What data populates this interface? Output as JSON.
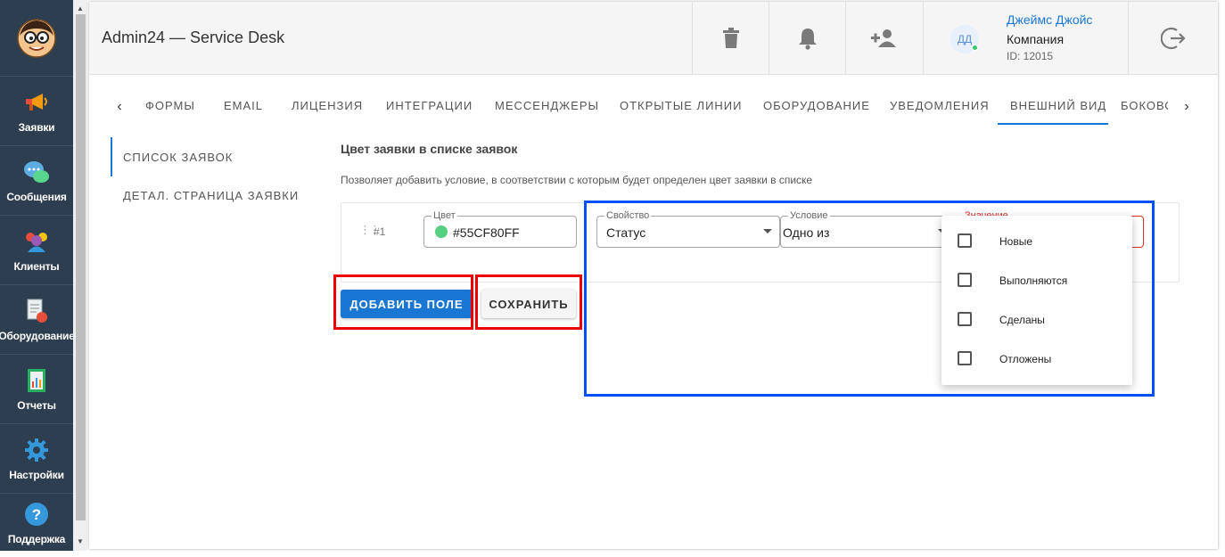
{
  "sidebar": {
    "items": [
      {
        "label": "Заявки",
        "icon": "megaphone-icon"
      },
      {
        "label": "Сообщения",
        "icon": "chat-bubbles-icon"
      },
      {
        "label": "Клиенты",
        "icon": "users-group-icon"
      },
      {
        "label": "Оборудование",
        "icon": "equipment-doc-icon"
      },
      {
        "label": "Отчеты",
        "icon": "report-chart-icon"
      },
      {
        "label": "Настройки",
        "icon": "gear-icon"
      },
      {
        "label": "Поддержка",
        "icon": "help-circle-icon"
      }
    ]
  },
  "header": {
    "title": "Admin24 — Service Desk",
    "user": {
      "initials": "ДД",
      "name": "Джеймс Джойс",
      "company": "Компания",
      "id": "ID: 12015"
    }
  },
  "tabs": {
    "items": [
      "ФОРМЫ",
      "EMAIL",
      "ЛИЦЕНЗИЯ",
      "ИНТЕГРАЦИИ",
      "МЕССЕНДЖЕРЫ",
      "ОТКРЫТЫЕ ЛИНИИ",
      "ОБОРУДОВАНИЕ",
      "УВЕДОМЛЕНИЯ",
      "ВНЕШНИЙ ВИД",
      "БОКОВС"
    ],
    "active": "ВНЕШНИЙ ВИД"
  },
  "subnav": {
    "items": [
      "СПИСОК ЗАЯВОК",
      "ДЕТАЛ. СТРАНИЦА ЗАЯВКИ"
    ]
  },
  "section": {
    "title": "Цвет заявки в списке заявок",
    "description": "Позволяет добавить условие, в соответствии с которым будет определен цвет заявки в списке"
  },
  "rule": {
    "number": "#1",
    "color": {
      "label": "Цвет",
      "value": "#55CF80FF",
      "swatch": "#55CF80"
    },
    "property": {
      "label": "Свойство",
      "value": "Статус"
    },
    "condition": {
      "label": "Условие",
      "value": "Одно из"
    },
    "value_field": {
      "label": "Значение"
    }
  },
  "dropdown": {
    "options": [
      "Новые",
      "Выполняются",
      "Сделаны",
      "Отложены"
    ]
  },
  "buttons": {
    "add_field": "ДОБАВИТЬ ПОЛЕ",
    "save": "СОХРАНИТЬ"
  },
  "colors": {
    "sidebar_bg": "#2c3e50",
    "accent": "#1976d2",
    "annotation_red": "#ee0000",
    "annotation_blue": "#0050ff"
  }
}
